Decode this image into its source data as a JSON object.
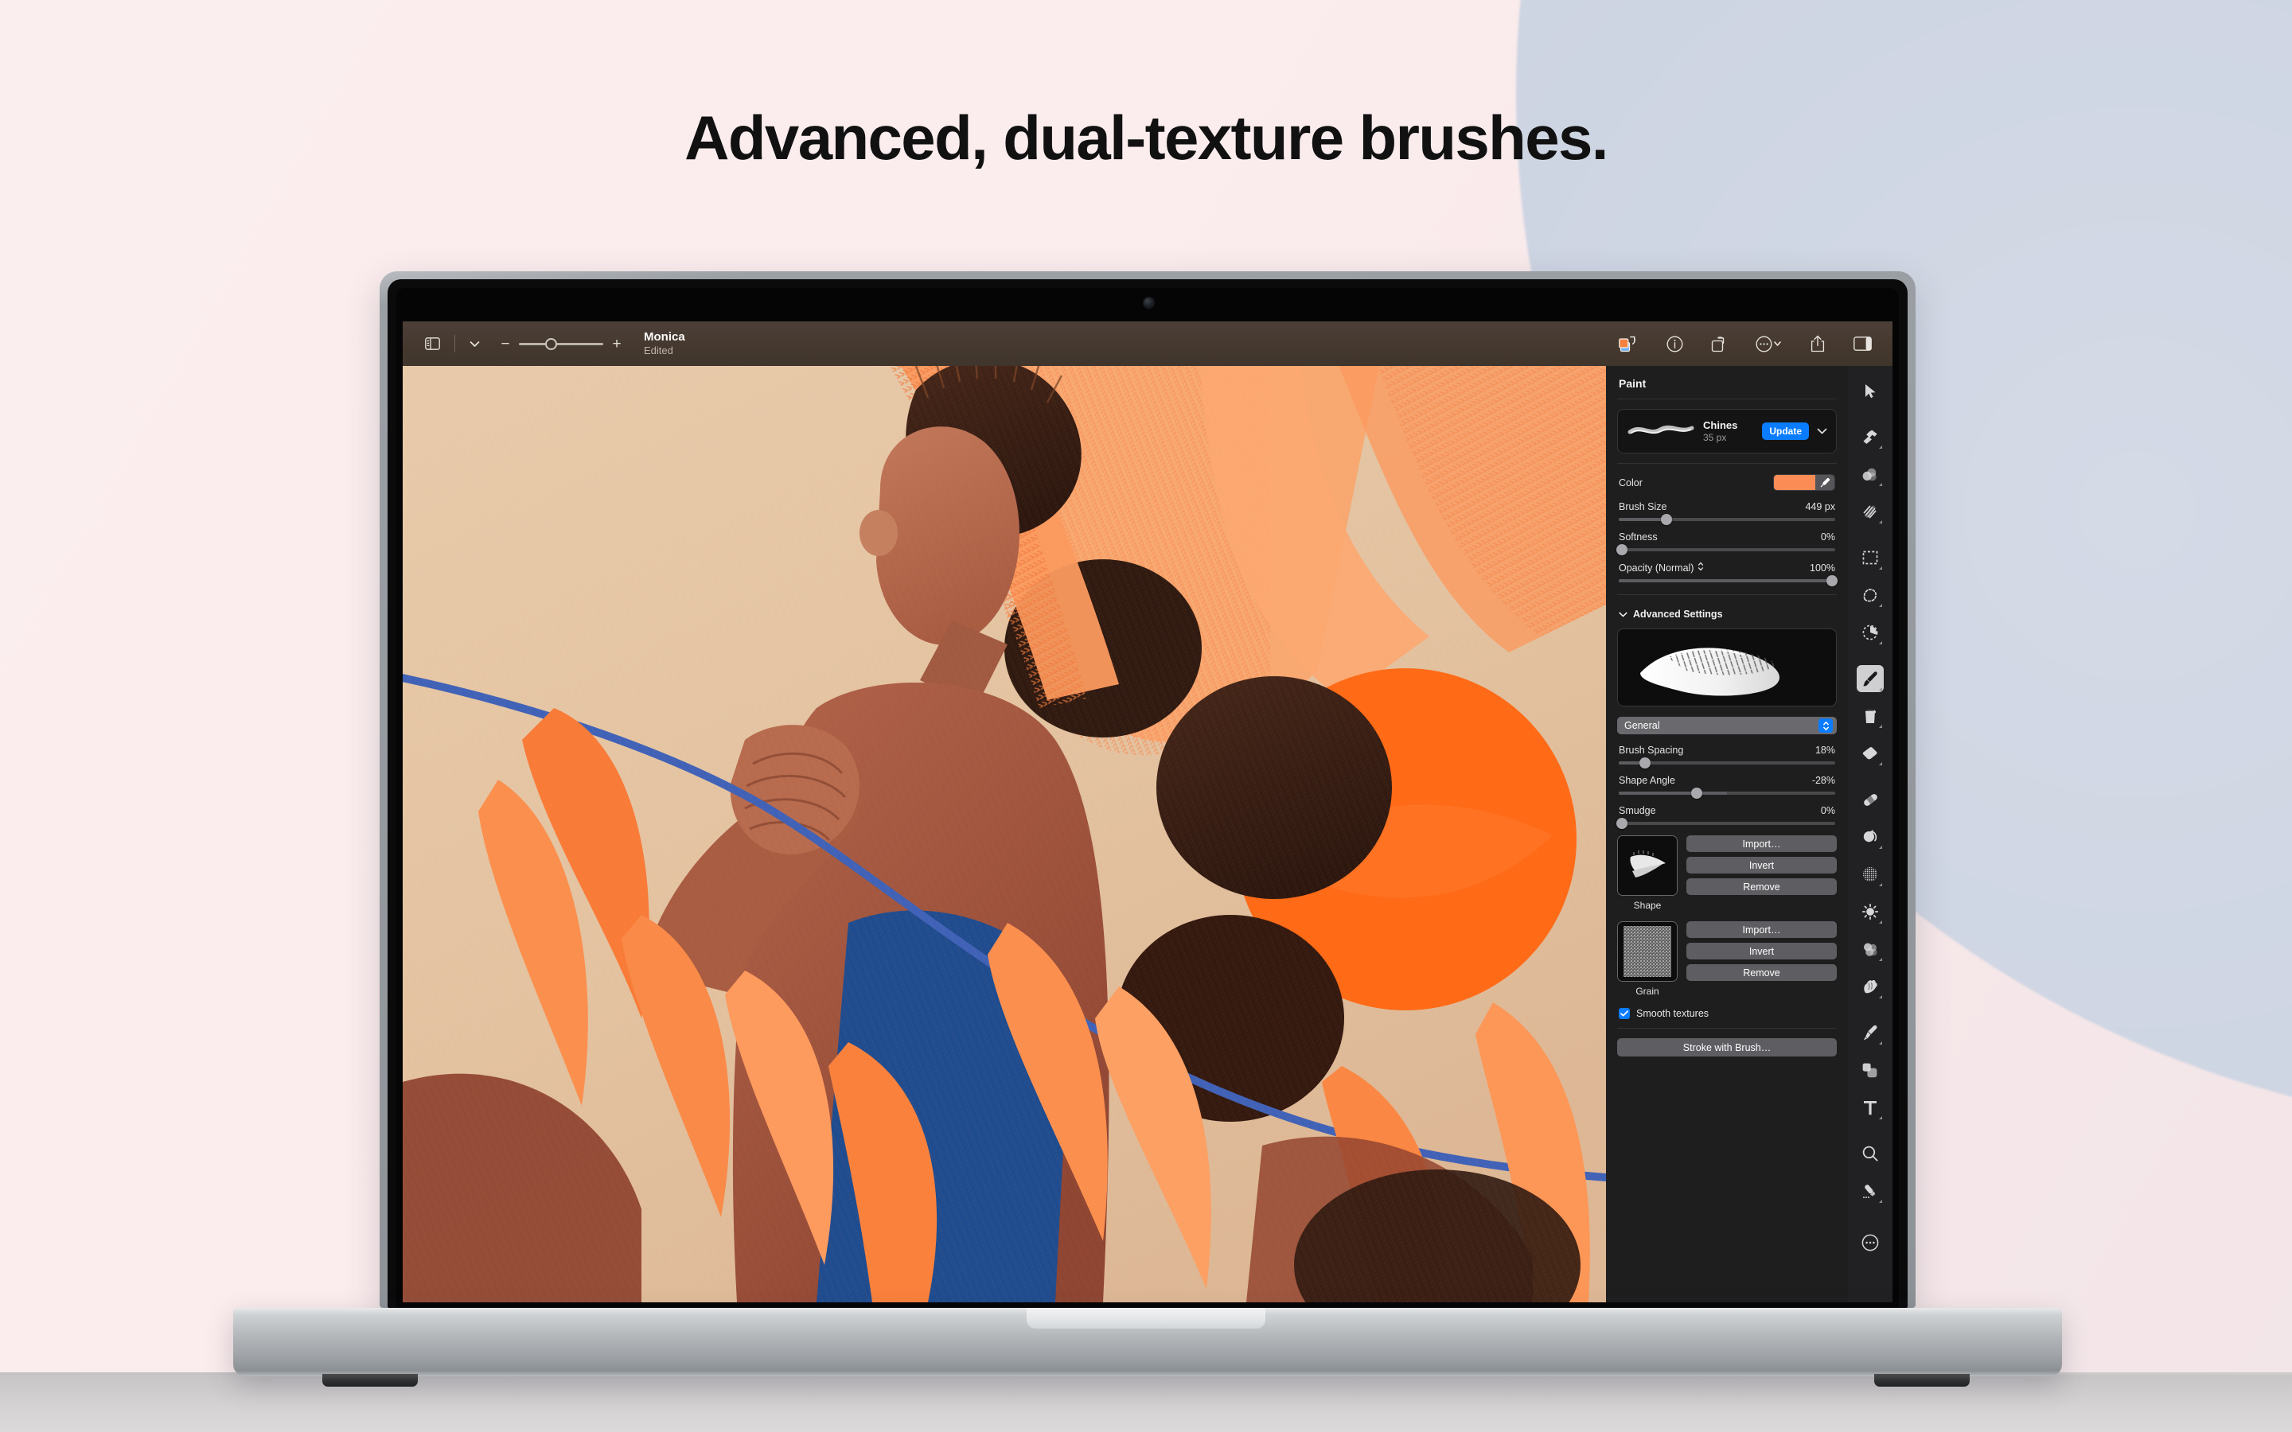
{
  "headline": "Advanced, dual-texture brushes.",
  "toolbar": {
    "sidebar_icon": "sidebar-panel-icon",
    "chevron_icon": "chevron-down-icon",
    "zoom_out_label": "−",
    "zoom_in_label": "+",
    "zoom_value": 33,
    "document_name": "Monica",
    "document_state": "Edited",
    "right_icons": [
      {
        "name": "color-swap-icon",
        "label": "Swap Colors"
      },
      {
        "name": "info-circle-icon",
        "label": "Info"
      },
      {
        "name": "rotate-icon",
        "label": "Rotate"
      },
      {
        "name": "more-options-icon",
        "label": "More"
      },
      {
        "name": "share-icon",
        "label": "Share"
      },
      {
        "name": "inspector-toggle-icon",
        "label": "Toggle Inspector"
      }
    ]
  },
  "paint_panel": {
    "title": "Paint",
    "brush": {
      "name": "Chines",
      "size_label": "35 px",
      "update_label": "Update",
      "chevron_icon": "chevron-down-icon"
    },
    "color": {
      "label": "Color",
      "swatch_hex": "#fb8c55",
      "eyedropper_icon": "eyedropper-icon"
    },
    "sliders": [
      {
        "label": "Brush Size",
        "value": "449 px",
        "percent": 22
      },
      {
        "label": "Softness",
        "value": "0%",
        "percent": 0
      },
      {
        "label": "Opacity (Normal)",
        "value": "100%",
        "percent": 100,
        "stepper_icon": "updown-stepper-icon"
      }
    ],
    "advanced": {
      "label": "Advanced Settings",
      "disclosure_icon": "chevron-down-icon",
      "preview_alt": "dual-texture-brush-preview",
      "select_value": "General",
      "stepper_icon": "updown-stepper-icon",
      "sliders": [
        {
          "label": "Brush Spacing",
          "value": "18%",
          "percent": 12
        },
        {
          "label": "Shape Angle",
          "value": "-28%",
          "percent": 36
        },
        {
          "label": "Smudge",
          "value": "0%",
          "percent": 0
        }
      ],
      "textures": [
        {
          "caption": "Shape",
          "buttons": [
            "Import…",
            "Invert",
            "Remove"
          ]
        },
        {
          "caption": "Grain",
          "buttons": [
            "Import…",
            "Invert",
            "Remove"
          ]
        }
      ],
      "smooth_textures": {
        "label": "Smooth textures",
        "checked": true,
        "check_icon": "checkmark-icon"
      },
      "stroke_button": "Stroke with Brush…"
    }
  },
  "tool_rail": [
    {
      "name": "arrow-select-tool",
      "selected": false,
      "submenu": false
    },
    {
      "name": "repair-hammer-tool",
      "selected": false,
      "submenu": true
    },
    {
      "name": "retouch-tool",
      "selected": false,
      "submenu": true
    },
    {
      "name": "clone-tool",
      "selected": false,
      "submenu": true
    },
    {
      "name": "rectangle-select-tool",
      "selected": false,
      "submenu": true
    },
    {
      "name": "freehand-select-tool",
      "selected": false,
      "submenu": true
    },
    {
      "name": "quick-select-tool",
      "selected": false,
      "submenu": true
    },
    {
      "name": "paint-brush-tool",
      "selected": true,
      "submenu": true
    },
    {
      "name": "paint-bucket-tool",
      "selected": false,
      "submenu": true
    },
    {
      "name": "eraser-tool",
      "selected": false,
      "submenu": true
    },
    {
      "name": "bandage-repair-tool",
      "selected": false,
      "submenu": false
    },
    {
      "name": "dodge-tool",
      "selected": false,
      "submenu": true
    },
    {
      "name": "noise-tool",
      "selected": false,
      "submenu": true
    },
    {
      "name": "brightness-tool",
      "selected": false,
      "submenu": true
    },
    {
      "name": "blur-tool",
      "selected": false,
      "submenu": true
    },
    {
      "name": "smudge-tool",
      "selected": false,
      "submenu": true
    },
    {
      "name": "pen-tool",
      "selected": false,
      "submenu": true
    },
    {
      "name": "shapes-tool",
      "selected": false,
      "submenu": false
    },
    {
      "name": "text-tool",
      "selected": false,
      "submenu": true
    },
    {
      "name": "magnifier-tool",
      "selected": false,
      "submenu": false
    },
    {
      "name": "gradient-tool",
      "selected": false,
      "submenu": true
    },
    {
      "name": "more-tools-button",
      "selected": false,
      "submenu": false
    }
  ],
  "artwork": {
    "title": "Monica",
    "description": "Illustrated portrait of a woman with dark hair bun holding a blue plant stem, surrounded by orange leaves and textured brush strokes",
    "palette": {
      "canvas_bg": "#e3c3a1",
      "orange_light": "#fb9a62",
      "orange_bright": "#ff6a16",
      "orange_mid": "#f97b38",
      "brown_dark": "#3a2118",
      "skin": "#b76b4e",
      "skin_shadow": "#8c3f2c",
      "blue_stem": "#3f62b8",
      "blue_cloth": "#1f4c8f"
    }
  }
}
